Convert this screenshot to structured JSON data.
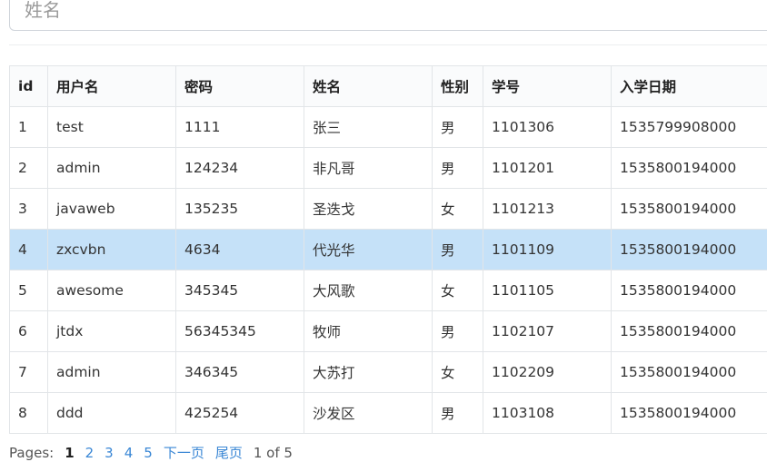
{
  "search": {
    "placeholder": "姓名"
  },
  "table": {
    "columns": [
      "id",
      "用户名",
      "密码",
      "姓名",
      "性别",
      "学号",
      "入学日期"
    ],
    "rows": [
      [
        "1",
        "test",
        "1111",
        "张三",
        "男",
        "1101306",
        "1535799908000"
      ],
      [
        "2",
        "admin",
        "124234",
        "非凡哥",
        "男",
        "1101201",
        "1535800194000"
      ],
      [
        "3",
        "javaweb",
        "135235",
        "圣迭戈",
        "女",
        "1101213",
        "1535800194000"
      ],
      [
        "4",
        "zxcvbn",
        "4634",
        "代光华",
        "男",
        "1101109",
        "1535800194000"
      ],
      [
        "5",
        "awesome",
        "345345",
        "大风歌",
        "女",
        "1101105",
        "1535800194000"
      ],
      [
        "6",
        "jtdx",
        "56345345",
        "牧师",
        "男",
        "1102107",
        "1535800194000"
      ],
      [
        "7",
        "admin",
        "346345",
        "大苏打",
        "女",
        "1102209",
        "1535800194000"
      ],
      [
        "8",
        "ddd",
        "425254",
        "沙发区",
        "男",
        "1103108",
        "1535800194000"
      ]
    ],
    "selected_row_index": 3,
    "selected_color": "#c5e1f8"
  },
  "pager": {
    "label": "Pages:",
    "current": "1",
    "pages": [
      "2",
      "3",
      "4",
      "5"
    ],
    "next_label": "下一页",
    "last_label": "尾页",
    "status": "1 of 5"
  },
  "colors": {
    "link": "#3a87d5",
    "border": "#e2e5e8"
  }
}
